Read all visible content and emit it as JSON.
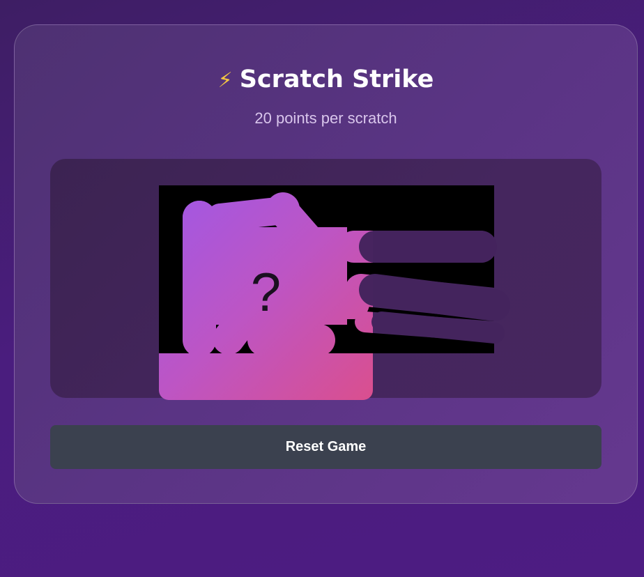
{
  "game": {
    "title": "Scratch Strike",
    "title_icon": "lightning-bolt-icon",
    "title_icon_glyph": "⚡",
    "subtitle": "20 points per scratch",
    "card_symbol": "?",
    "reset_label": "Reset Game"
  },
  "colors": {
    "background": "#4a1d7e",
    "panel": "#5a3484",
    "game_area": "#42255a",
    "card_gradient_start": "#9f58e6",
    "card_gradient_end": "#da4f8e",
    "scratch_cover": "#000000",
    "button": "#3b414f",
    "bolt": "#f4c542"
  }
}
